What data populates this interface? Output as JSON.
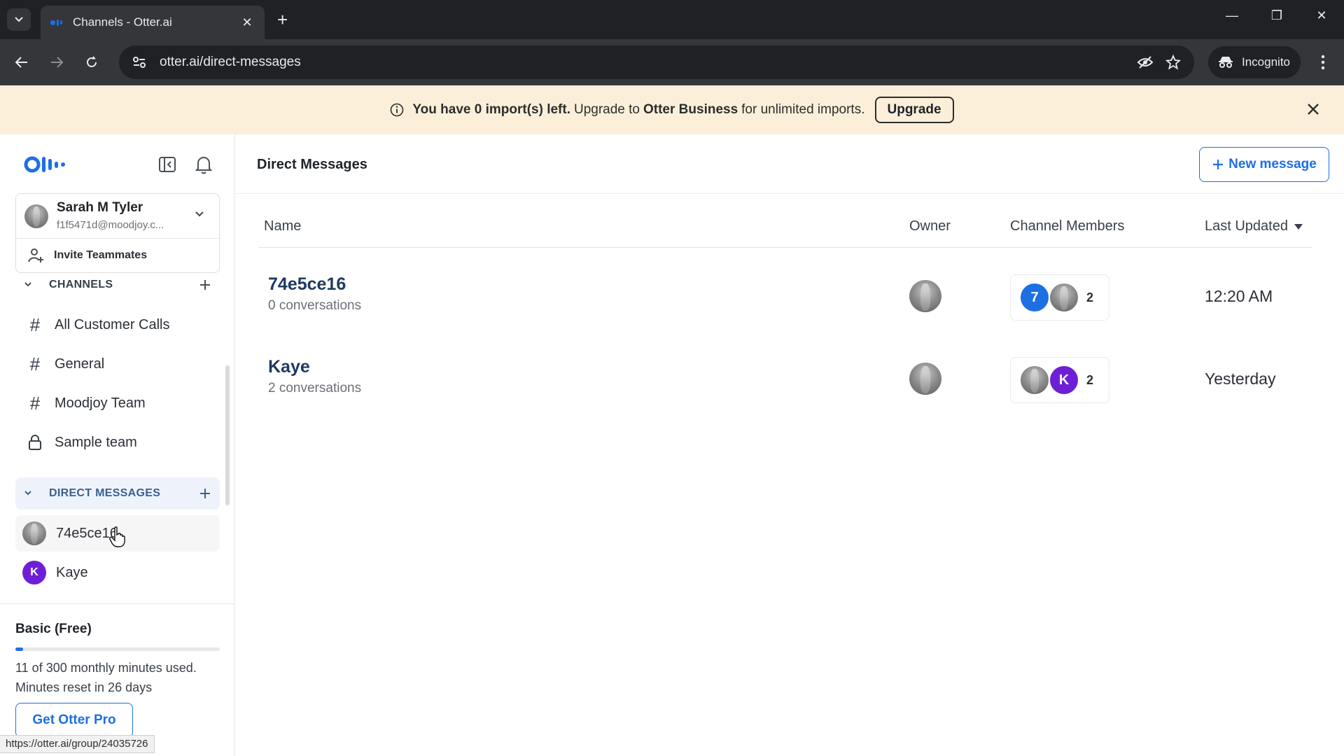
{
  "browser": {
    "tab_title": "Channels - Otter.ai",
    "url": "otter.ai/direct-messages",
    "incognito_label": "Incognito",
    "status_url": "https://otter.ai/group/24035726"
  },
  "banner": {
    "part1": "You have 0 import(s) left.",
    "part2": "Upgrade to",
    "part3": "Otter Business",
    "part4": "for unlimited imports.",
    "button": "Upgrade"
  },
  "sidebar": {
    "user_name": "Sarah M Tyler",
    "user_email": "f1f5471d@moodjoy.c...",
    "invite_label": "Invite Teammates",
    "channels_header": "CHANNELS",
    "channels": [
      {
        "label": "All Customer Calls",
        "icon": "hash-icon"
      },
      {
        "label": "General",
        "icon": "hash-icon"
      },
      {
        "label": "Moodjoy Team",
        "icon": "hash-icon"
      },
      {
        "label": "Sample team",
        "icon": "lock-icon"
      }
    ],
    "dm_header": "DIRECT MESSAGES",
    "dms": [
      {
        "label": "74e5ce16"
      },
      {
        "label": "Kaye",
        "initial": "K"
      }
    ],
    "plan_name": "Basic (Free)",
    "minutes_used": 11,
    "minutes_total": 300,
    "usage_line1": "11 of 300 monthly minutes used.",
    "usage_line2": "Minutes reset in 26 days",
    "cta_button": "Get Otter Pro"
  },
  "main": {
    "title": "Direct Messages",
    "new_message_button": "New message",
    "columns": {
      "name": "Name",
      "owner": "Owner",
      "members": "Channel Members",
      "updated": "Last Updated"
    },
    "rows": [
      {
        "name": "74e5ce16",
        "conversations": "0 conversations",
        "member_initial": "7",
        "member_count": "2",
        "last_updated": "12:20 AM"
      },
      {
        "name": "Kaye",
        "conversations": "2 conversations",
        "member_initial": "K",
        "member_count": "2",
        "last_updated": "Yesterday"
      }
    ]
  },
  "colors": {
    "accent_blue": "#1d6fe3",
    "kaye_purple": "#6e1fd6",
    "banner_bg": "#fbefd9"
  }
}
